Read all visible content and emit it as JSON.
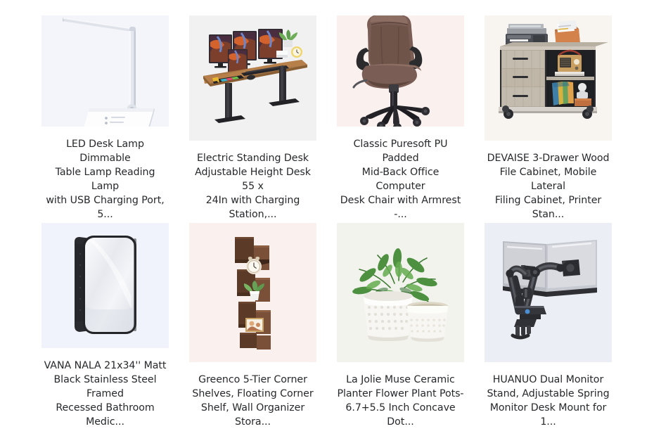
{
  "page": {
    "layout": "product-grid",
    "columns": 4,
    "rows": 2,
    "background": "#ffffff",
    "title_color": "#26282b"
  },
  "products": [
    {
      "index": 1,
      "title": "LED Desk Lamp Dimmable\nTable Lamp Reading Lamp\nwith USB Charging Port, 5...",
      "image_name": "led-desk-lamp-image",
      "image_bg": "#f4f5fb"
    },
    {
      "index": 2,
      "title": "Electric Standing Desk\nAdjustable Height Desk 55 x\n24In with Charging Station,...",
      "image_name": "electric-standing-desk-image",
      "image_bg": "#f1f1f1"
    },
    {
      "index": 3,
      "title": "Classic Puresoft PU Padded\nMid-Back Office Computer\nDesk Chair with Armrest -...",
      "image_name": "office-desk-chair-image",
      "image_bg": "#faf0ee"
    },
    {
      "index": 4,
      "title": "DEVAISE 3-Drawer Wood\nFile Cabinet, Mobile Lateral\nFiling Cabinet, Printer Stan...",
      "image_name": "file-cabinet-image",
      "image_bg": "#f8f5f1"
    },
    {
      "index": 5,
      "title": "VANA NALA 21x34'' Matt\nBlack Stainless Steel Framed\nRecessed Bathroom Medic...",
      "image_name": "bathroom-medicine-cabinet-mirror-image",
      "image_bg": "#f1f3fc"
    },
    {
      "index": 6,
      "title": "Greenco 5-Tier Corner\nShelves, Floating Corner\nShelf, Wall Organizer Stora...",
      "image_name": "corner-shelves-image",
      "image_bg": "#faf0ee"
    },
    {
      "index": 7,
      "title": "La Jolie Muse Ceramic\nPlanter Flower Plant Pots-\n6.7+5.5 Inch Concave Dot...",
      "image_name": "ceramic-planter-pots-image",
      "image_bg": "#f2f3ed"
    },
    {
      "index": 8,
      "title": "HUANUO Dual Monitor\nStand, Adjustable Spring\nMonitor Desk Mount for 1...",
      "image_name": "dual-monitor-stand-image",
      "image_bg": "#eceef5"
    }
  ]
}
